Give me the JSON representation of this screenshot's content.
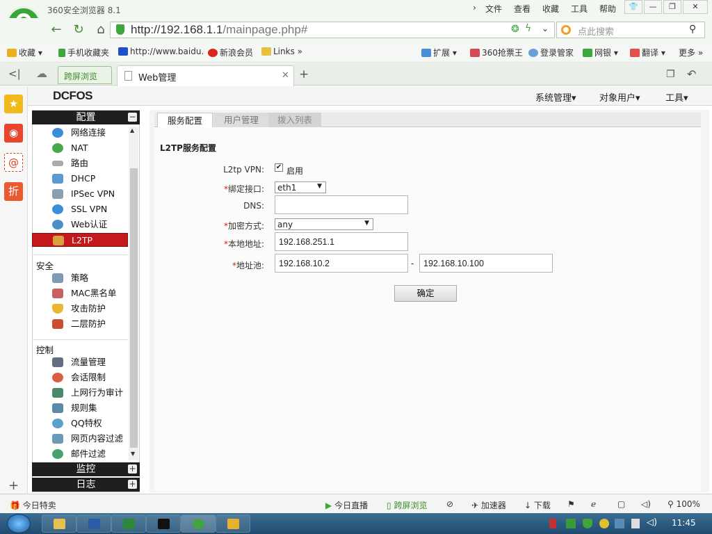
{
  "browser": {
    "app_title": "360安全浏览器 8.1",
    "menus": [
      "文件",
      "查看",
      "收藏",
      "工具",
      "帮助"
    ],
    "url_host": "http://192.168.1.1",
    "url_path": "/mainpage.php#",
    "search_placeholder": "点此搜索",
    "bookmarks": [
      "收藏",
      "手机收藏夹",
      "http://www.baidu.",
      "新浪会员",
      "Links"
    ],
    "bookmark_right": [
      "扩展",
      "360抢票王",
      "登录管家",
      "网银",
      "翻译",
      "更多"
    ],
    "tabs": [
      "跨屏浏览",
      "Web管理"
    ]
  },
  "app": {
    "brand": "DCFOS",
    "top_menu": [
      "系统管理",
      "对象用户",
      "工具"
    ]
  },
  "sidebar": {
    "sections": {
      "config": "配置",
      "monitor": "监控",
      "log": "日志"
    },
    "config_items": [
      "网络连接",
      "NAT",
      "路由",
      "DHCP",
      "IPSec VPN",
      "SSL VPN",
      "Web认证",
      "L2TP"
    ],
    "security_title": "安全",
    "security_items": [
      "策略",
      "MAC黑名单",
      "攻击防护",
      "二层防护"
    ],
    "control_title": "控制",
    "control_items": [
      "流量管理",
      "会话限制",
      "上网行为审计",
      "规则集",
      "QQ特权",
      "网页内容过滤",
      "邮件过滤"
    ]
  },
  "content": {
    "tabs": [
      "服务配置",
      "用户管理",
      "拨入列表"
    ],
    "heading": "L2TP服务配置",
    "fields": {
      "vpn_label": "L2tp VPN:",
      "vpn_enabled_label": "启用",
      "vpn_enabled": true,
      "iface_label": "绑定接口:",
      "iface_value": "eth1",
      "dns_label": "DNS:",
      "dns_value": "",
      "enc_label": "加密方式:",
      "enc_value": "any",
      "local_label": "本地地址:",
      "local_value": "192.168.251.1",
      "pool_label": "地址池:",
      "pool_start": "192.168.10.2",
      "pool_sep": "-",
      "pool_end": "192.168.10.100"
    },
    "submit": "确定"
  },
  "statusbar": {
    "left": "今日特卖",
    "items": [
      "今日直播",
      "跨屏浏览",
      "加速器",
      "下载"
    ],
    "zoom": "100%"
  },
  "taskbar": {
    "clock": "11:45"
  }
}
